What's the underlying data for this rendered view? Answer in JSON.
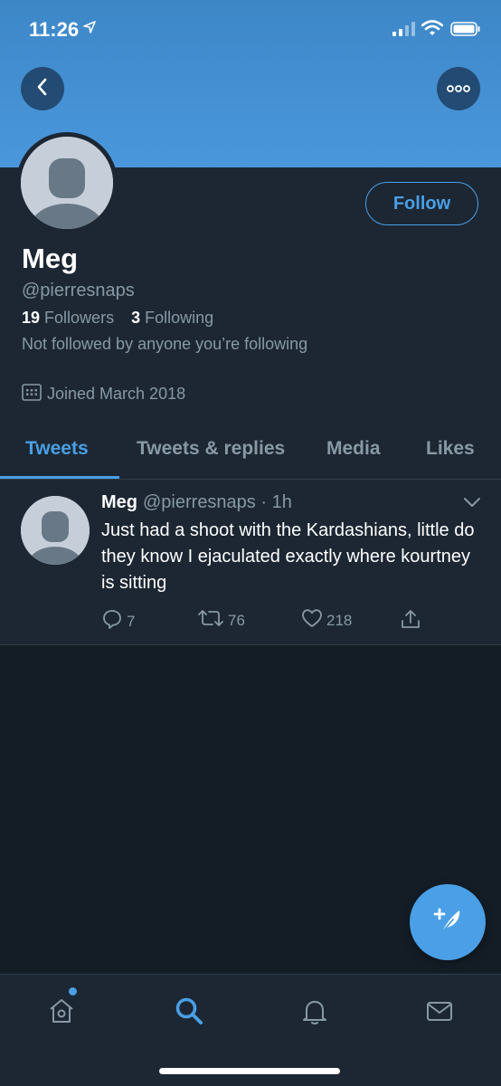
{
  "status_bar": {
    "time": "11:26"
  },
  "profile": {
    "name": "Meg",
    "handle": "@pierresnaps",
    "followers_count": "19",
    "followers_label": "Followers",
    "following_count": "3",
    "following_label": "Following",
    "not_followed_text": "Not followed by anyone you’re following",
    "joined_text": "Joined March 2018",
    "follow_label": "Follow"
  },
  "tabs": [
    {
      "label": "Tweets",
      "active": true
    },
    {
      "label": "Tweets & replies",
      "active": false
    },
    {
      "label": "Media",
      "active": false
    },
    {
      "label": "Likes",
      "active": false
    }
  ],
  "tweet": {
    "name": "Meg",
    "handle_time": "@pierresnaps · 1h",
    "text": "Just had a shoot with the Kardashians, little do they know I ejaculated exactly where kourtney is sitting",
    "replies": "7",
    "retweets": "76",
    "likes": "218"
  },
  "colors": {
    "accent": "#4a9fe6",
    "banner": "#4a97dc",
    "background": "#141d26",
    "surface": "#1c2733",
    "muted_text": "#8899a6"
  },
  "icons": {
    "back": "chevron-left-icon",
    "more": "more-dots-icon",
    "calendar": "calendar-icon",
    "reply": "reply-icon",
    "retweet": "retweet-icon",
    "like": "heart-icon",
    "share": "share-icon",
    "compose": "compose-tweet-icon",
    "home": "home-icon",
    "search": "search-icon",
    "notifications": "bell-icon",
    "messages": "mail-icon"
  }
}
